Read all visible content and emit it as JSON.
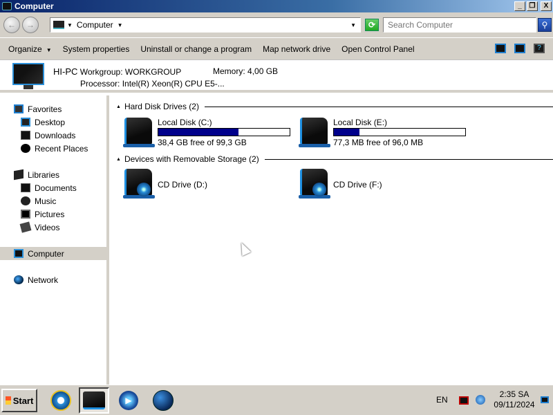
{
  "window": {
    "title": "Computer",
    "controls": {
      "minimize": "_",
      "maximize": "❐",
      "close": "X"
    }
  },
  "address_bar": {
    "back_glyph": "←",
    "forward_glyph": "→",
    "crumb": "Computer",
    "search_placeholder": "Search Computer",
    "search_glyph": "⚲",
    "refresh_glyph": "⟳"
  },
  "toolbar": {
    "organize": "Organize",
    "system_properties": "System properties",
    "uninstall": "Uninstall or change a program",
    "map_drive": "Map network drive",
    "control_panel": "Open Control Panel",
    "help_glyph": "?"
  },
  "details": {
    "pc_name": "HI-PC",
    "workgroup_label": "Workgroup:",
    "workgroup": "WORKGROUP",
    "memory_label": "Memory:",
    "memory": "4,00 GB",
    "processor_label": "Processor:",
    "processor": "Intel(R) Xeon(R) CPU E5-..."
  },
  "nav": {
    "favorites": "Favorites",
    "desktop": "Desktop",
    "downloads": "Downloads",
    "recent": "Recent Places",
    "libraries": "Libraries",
    "documents": "Documents",
    "music": "Music",
    "pictures": "Pictures",
    "videos": "Videos",
    "computer": "Computer",
    "network": "Network"
  },
  "groups": {
    "hdd": "Hard Disk Drives (2)",
    "removable": "Devices with Removable Storage (2)"
  },
  "drives": {
    "c": {
      "name": "Local Disk (C:)",
      "free": "38,4 GB free of 99,3 GB",
      "used_fraction": 0.613
    },
    "e": {
      "name": "Local Disk (E:)",
      "free": "77,3 MB free of 96,0 MB",
      "used_fraction": 0.195
    },
    "d": {
      "name": "CD Drive (D:)"
    },
    "f": {
      "name": "CD Drive (F:)"
    }
  },
  "taskbar": {
    "start": "Start",
    "wmp_glyph": "▶",
    "language": "EN",
    "time": "2:35 SA",
    "date": "09/11/2024"
  }
}
